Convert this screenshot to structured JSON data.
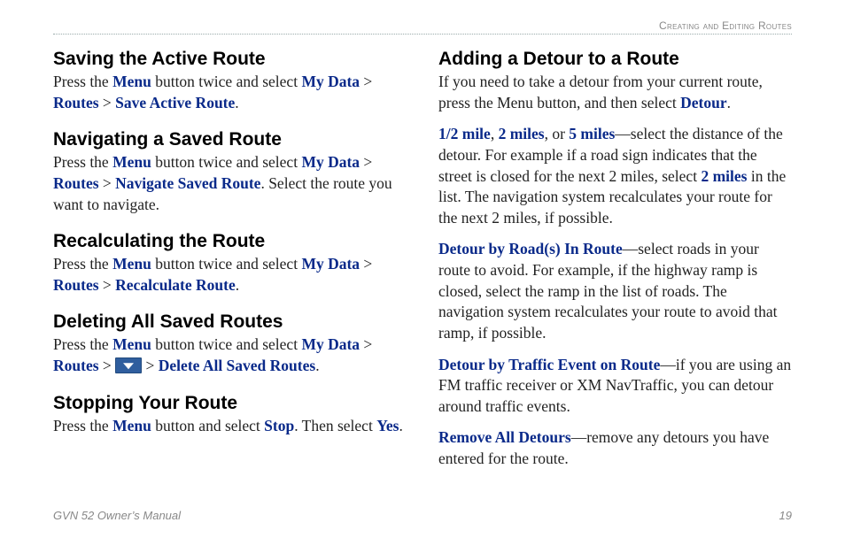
{
  "header": {
    "section": "Creating and Editing Routes"
  },
  "left": {
    "s1": {
      "title": "Saving the Active Route",
      "t1": "Press the ",
      "k1": "Menu",
      "t2": " button twice and select ",
      "k2": "My Data",
      "t3": " > ",
      "k3": "Routes",
      "t4": " > ",
      "k4": "Save Active Route",
      "t5": "."
    },
    "s2": {
      "title": "Navigating a Saved Route",
      "t1": "Press the ",
      "k1": "Menu",
      "t2": " button twice and select ",
      "k2": "My Data",
      "t3": " > ",
      "k3": "Routes",
      "t4": " > ",
      "k4": "Navigate Saved Route",
      "t5": ". Select the route you want to navigate."
    },
    "s3": {
      "title": "Recalculating the Route",
      "t1": "Press the ",
      "k1": "Menu",
      "t2": " button twice and select ",
      "k2": "My Data",
      "t3": " > ",
      "k3": "Routes",
      "t4": " > ",
      "k4": "Recalculate Route",
      "t5": "."
    },
    "s4": {
      "title": "Deleting All Saved Routes",
      "t1": "Press the ",
      "k1": "Menu",
      "t2": " button twice and select ",
      "k2": "My Data",
      "t3": " > ",
      "k3": "Routes",
      "t4": " > ",
      "t5": " > ",
      "k5": "Delete All Saved Routes",
      "t6": "."
    },
    "s5": {
      "title": "Stopping Your Route",
      "t1": "Press the ",
      "k1": "Menu",
      "t2": " button and select ",
      "k2": "Stop",
      "t3": ". Then select ",
      "k3": "Yes",
      "t4": "."
    }
  },
  "right": {
    "title": "Adding a Detour to a Route",
    "p1": {
      "t1": "If you need to take a detour from your current route, press the Menu button, and then select ",
      "k1": "Detour",
      "t2": "."
    },
    "p2": {
      "k1": "1/2 mile",
      "t1": ", ",
      "k2": "2 miles",
      "t2": ", or ",
      "k3": "5 miles",
      "t3": "—select the distance of the detour. For example if a road sign indicates that the street is closed for the next 2 miles, select ",
      "k4": "2 miles",
      "t4": " in the list. The navigation system recalculates your route for the next 2 miles, if possible."
    },
    "p3": {
      "k1": "Detour by Road(s) In Route",
      "t1": "—select roads in your route to avoid. For example, if the highway ramp is closed, select the ramp in the list of roads. The navigation system recalculates your route to avoid that ramp, if possible."
    },
    "p4": {
      "k1": "Detour by Traffic Event on Route",
      "t1": "—if you are using an FM traffic receiver or XM NavTraffic, you can detour around traffic events."
    },
    "p5": {
      "k1": "Remove All Detours",
      "t1": "—remove any detours you have entered for the route."
    }
  },
  "footer": {
    "manual": "GVN 52 Owner’s Manual",
    "page": "19"
  }
}
